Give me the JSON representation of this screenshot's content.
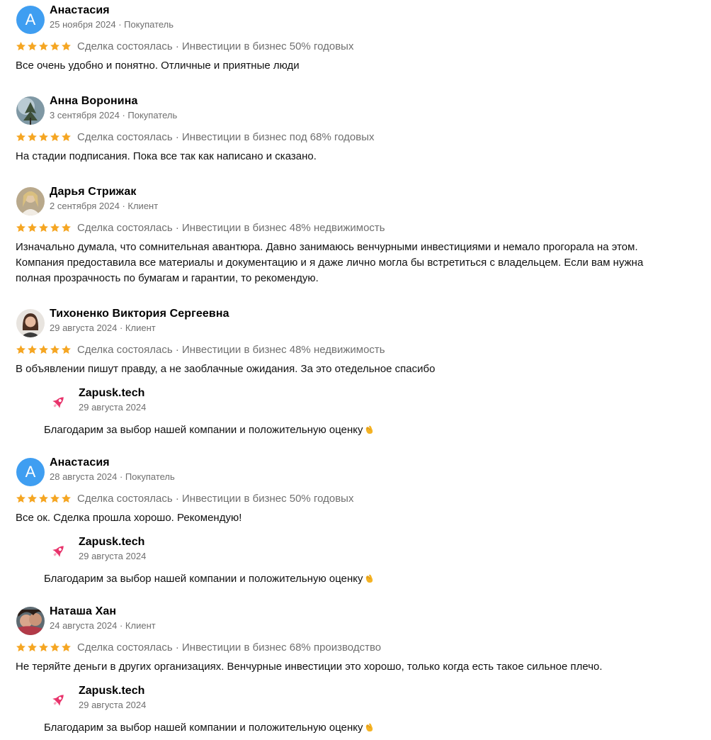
{
  "colors": {
    "star": "#f5a623",
    "meta": "#6f6f6f",
    "letter_avatar": "#3f9ef1",
    "logo": "#e8336b"
  },
  "reviews": [
    {
      "avatar": {
        "type": "letter",
        "letter": "А"
      },
      "name": "Анастасия",
      "meta": "25 ноября 2024 · Покупатель",
      "rating": 5,
      "deal": "Сделка состоялась · Инвестиции в бизнес 50% годовых",
      "text": "Все очень удобно и понятно. Отличные и приятные люди"
    },
    {
      "avatar": {
        "type": "photo",
        "icon": "user-photo-icon"
      },
      "name": "Анна Воронина",
      "meta": "3 сентября 2024 · Покупатель",
      "rating": 5,
      "deal": "Сделка состоялась · Инвестиции в бизнес под 68% годовых",
      "text": "На стадии подписания. Пока все так как написано и сказано."
    },
    {
      "avatar": {
        "type": "photo",
        "icon": "user-photo-icon"
      },
      "name": "Дарья Стрижак",
      "meta": "2 сентября 2024 · Клиент",
      "rating": 5,
      "deal": "Сделка состоялась · Инвестиции в бизнес 48% недвижимость",
      "text": "Изначально думала, что сомнительная авантюра. Давно занимаюсь венчурными инвестициями и немало прогорала на этом. Компания предоставила все материалы и документацию и я даже лично могла бы встретиться с владельцем. Если вам нужна полная прозрачность по бумагам и гарантии, то рекомендую."
    },
    {
      "avatar": {
        "type": "photo",
        "icon": "user-photo-icon"
      },
      "name": "Тихоненко Виктория Сергеевна",
      "meta": "29 августа 2024 · Клиент",
      "rating": 5,
      "deal": "Сделка состоялась · Инвестиции в бизнес 48% недвижимость",
      "text": "В объявлении пишут правду, а не заоблачные ожидания. За это отедельное спасибо",
      "reply": {
        "name": "Zapusk.tech",
        "date": "29 августа 2024",
        "text": "Благодарим за выбор нашей компании и положительную оценку",
        "emoji": "clapping-hands-icon"
      }
    },
    {
      "avatar": {
        "type": "letter",
        "letter": "А"
      },
      "name": "Анастасия",
      "meta": "28 августа 2024 · Покупатель",
      "rating": 5,
      "deal": "Сделка состоялась · Инвестиции в бизнес 50% годовых",
      "text": "Все ок. Сделка прошла хорошо. Рекомендую!",
      "reply": {
        "name": "Zapusk.tech",
        "date": "29 августа 2024",
        "text": "Благодарим за выбор нашей компании и положительную оценку",
        "emoji": "clapping-hands-icon"
      }
    },
    {
      "avatar": {
        "type": "photo",
        "icon": "user-photo-icon"
      },
      "name": "Наташа Хан",
      "meta": "24 августа 2024 · Клиент",
      "rating": 5,
      "deal": "Сделка состоялась · Инвестиции в бизнес 68% производство",
      "text": "Не теряйте деньги в других организациях. Венчурные инвестиции это хорошо, только когда есть такое сильное плечо.",
      "reply": {
        "name": "Zapusk.tech",
        "date": "29 августа 2024",
        "text": "Благодарим за выбор нашей компании и положительную оценку",
        "emoji": "clapping-hands-icon"
      }
    }
  ]
}
